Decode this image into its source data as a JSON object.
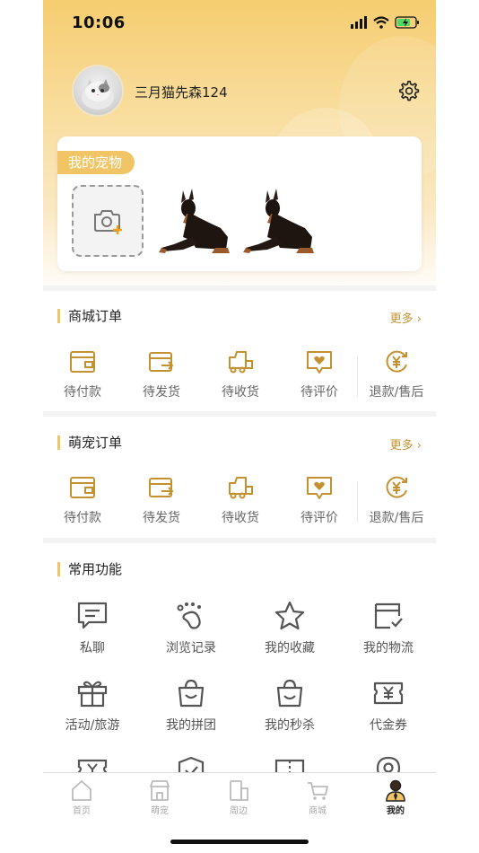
{
  "status_bar": {
    "time": "10:06"
  },
  "profile": {
    "username": "三月猫先森124"
  },
  "pets": {
    "tab_label": "我的宠物"
  },
  "mall_orders": {
    "title": "商城订单",
    "more": "更多",
    "items": [
      {
        "label": "待付款",
        "icon": "wallet-icon"
      },
      {
        "label": "待发货",
        "icon": "shipping-box-icon"
      },
      {
        "label": "待收货",
        "icon": "delivery-truck-icon"
      },
      {
        "label": "待评价",
        "icon": "review-heart-icon"
      },
      {
        "label": "退款/售后",
        "icon": "refund-yen-icon"
      }
    ]
  },
  "pet_orders": {
    "title": "萌宠订单",
    "more": "更多",
    "items": [
      {
        "label": "待付款",
        "icon": "wallet-icon"
      },
      {
        "label": "待发货",
        "icon": "shipping-box-icon"
      },
      {
        "label": "待收货",
        "icon": "delivery-truck-icon"
      },
      {
        "label": "待评价",
        "icon": "review-heart-icon"
      },
      {
        "label": "退款/售后",
        "icon": "refund-yen-icon"
      }
    ]
  },
  "functions": {
    "title": "常用功能",
    "items": [
      {
        "label": "私聊",
        "icon": "chat-icon"
      },
      {
        "label": "浏览记录",
        "icon": "paw-icon"
      },
      {
        "label": "我的收藏",
        "icon": "star-icon"
      },
      {
        "label": "我的物流",
        "icon": "logistics-icon"
      },
      {
        "label": "活动/旅游",
        "icon": "gift-icon"
      },
      {
        "label": "我的拼团",
        "icon": "shopping-bag-icon"
      },
      {
        "label": "我的秒杀",
        "icon": "flash-bag-icon"
      },
      {
        "label": "代金券",
        "icon": "voucher-icon"
      }
    ]
  },
  "tabbar": {
    "tabs": [
      {
        "label": "首页",
        "icon": "home-icon"
      },
      {
        "label": "萌宠",
        "icon": "shop-icon"
      },
      {
        "label": "周边",
        "icon": "nearby-icon"
      },
      {
        "label": "商城",
        "icon": "cart-icon"
      },
      {
        "label": "我的",
        "icon": "profile-icon",
        "active": true
      }
    ]
  },
  "colors": {
    "accent": "#f1c566",
    "icon_gold": "#c3912f",
    "icon_gray": "#555555"
  }
}
